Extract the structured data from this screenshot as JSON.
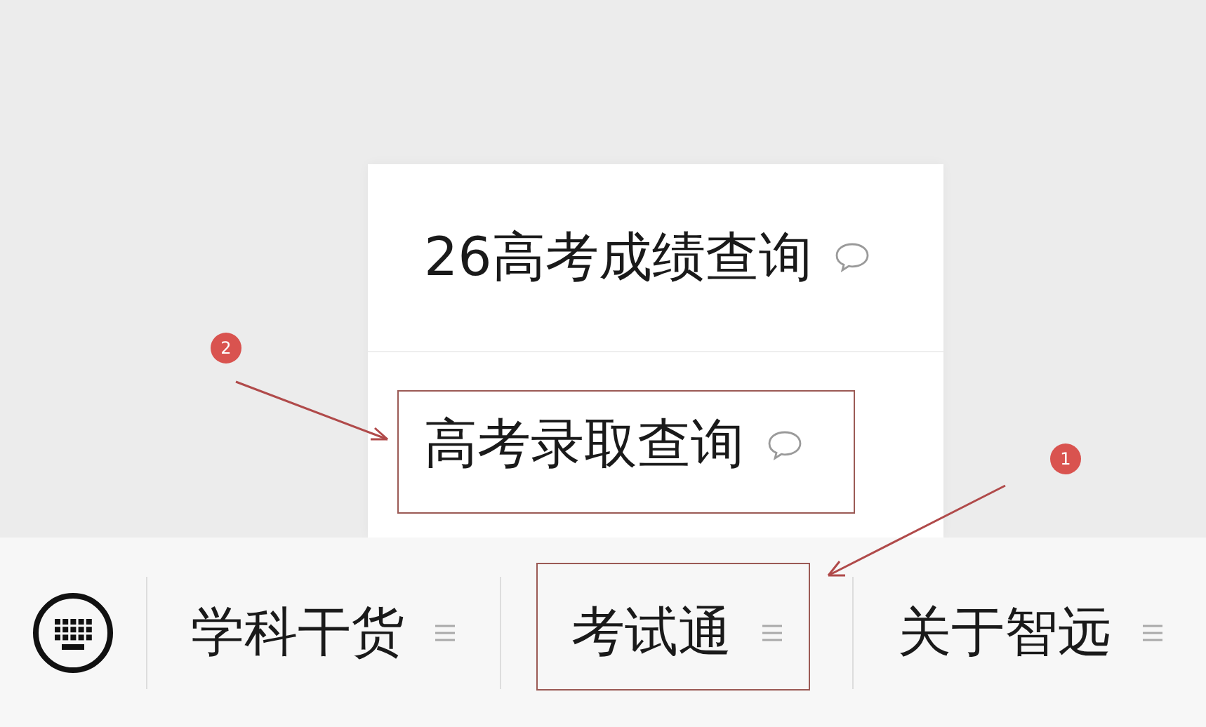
{
  "submenu": {
    "items": [
      {
        "label": "26高考成绩查询"
      },
      {
        "label": "高考录取查询"
      }
    ]
  },
  "menu_bar": {
    "items": [
      {
        "label": "学科干货"
      },
      {
        "label": "考试通"
      },
      {
        "label": "关于智远"
      }
    ]
  },
  "annotations": [
    {
      "number": "2"
    },
    {
      "number": "1"
    }
  ]
}
